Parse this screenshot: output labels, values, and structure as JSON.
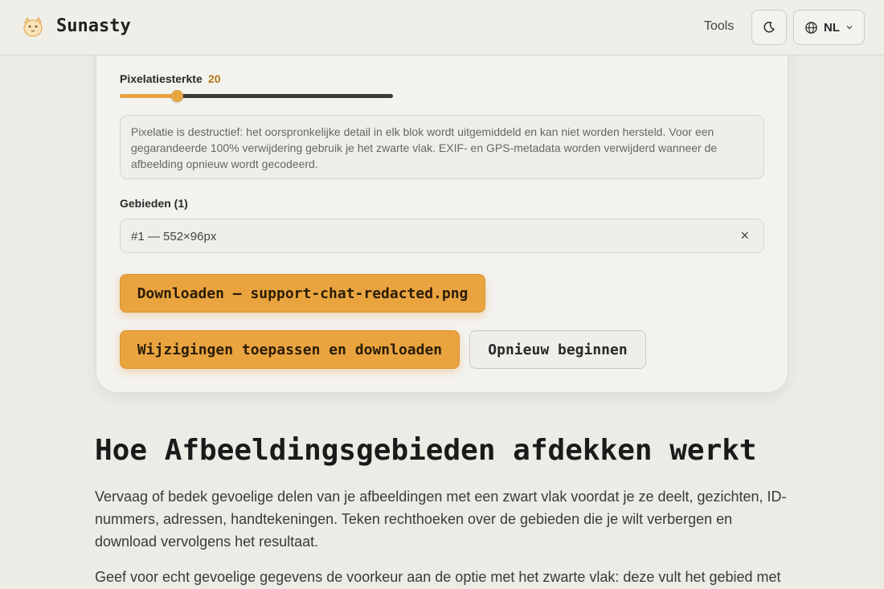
{
  "header": {
    "brand": "Sunasty",
    "tools_label": "Tools",
    "language": "NL",
    "logo_icon": "cat-logo-icon",
    "theme_icon": "moon-icon",
    "globe_icon": "globe-icon",
    "chevron_icon": "chevron-down-icon"
  },
  "editor": {
    "strength_label": "Pixelatiesterkte",
    "strength_value": "20",
    "slider_fraction": 0.21,
    "notice": "Pixelatie is destructief: het oorspronkelijke detail in elk blok wordt uitgemiddeld en kan niet worden hersteld. Voor een gegarandeerde 100% verwijdering gebruik je het zwarte vlak. EXIF- en GPS-metadata worden verwijderd wanneer de afbeelding opnieuw wordt gecodeerd.",
    "areas_label": "Gebieden (1)",
    "areas": [
      {
        "label": "#1 — 552×96px",
        "remove": "×"
      }
    ],
    "download_button": "Downloaden — support-chat-redacted.png",
    "apply_button": "Wijzigingen toepassen en downloaden",
    "restart_button": "Opnieuw beginnen"
  },
  "article": {
    "heading": "Hoe Afbeeldingsgebieden afdekken werkt",
    "paragraph1": "Vervaag of bedek gevoelige delen van je afbeeldingen met een zwart vlak voordat je ze deelt, gezichten, ID-nummers, adressen, handtekeningen. Teken rechthoeken over de gebieden die je wilt verbergen en download vervolgens het resultaat.",
    "paragraph2": "Geef voor echt gevoelige gegevens de voorkeur aan de optie met het zwarte vlak: deze vult het gebied met"
  },
  "colors": {
    "accent": "#eaa43f",
    "accent_text": "#b5791a",
    "background": "#ecebe6"
  }
}
